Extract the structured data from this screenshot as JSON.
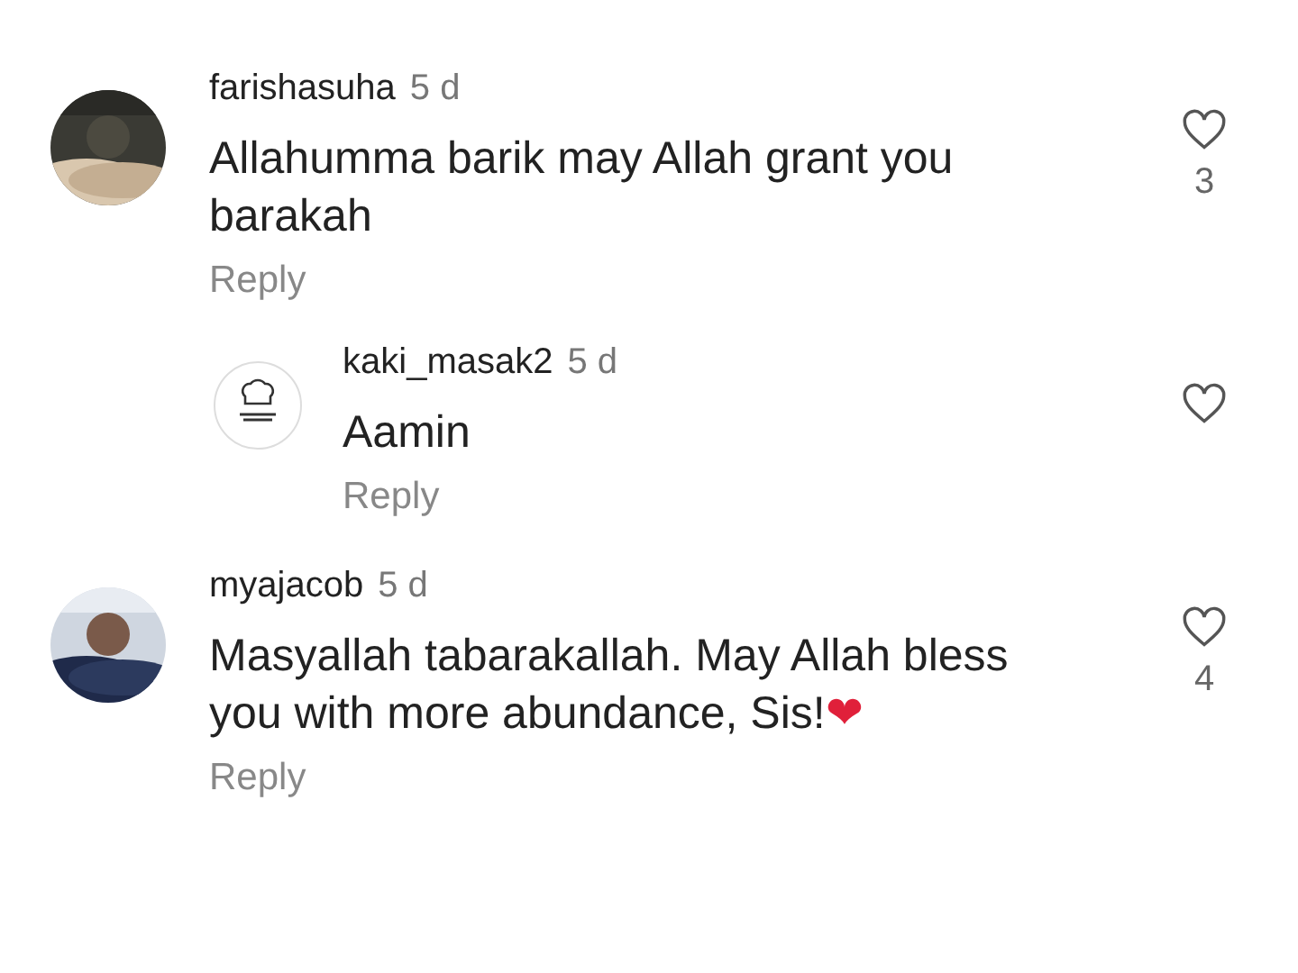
{
  "comments": [
    {
      "kind": "comment",
      "username": "farishasuha",
      "time": "5 d",
      "text": "Allahumma barik may Allah grant you barakah",
      "reply": "Reply",
      "likes": "3"
    },
    {
      "kind": "reply",
      "username": "kaki_masak2",
      "time": "5 d",
      "text": "Aamin",
      "reply": "Reply"
    },
    {
      "kind": "comment",
      "username": "myajacob",
      "time": "5 d",
      "text": "Masyallah tabarakallah. May Allah bless you with more abundance, Sis!",
      "emoji": "❤",
      "reply": "Reply",
      "likes": "4"
    }
  ]
}
